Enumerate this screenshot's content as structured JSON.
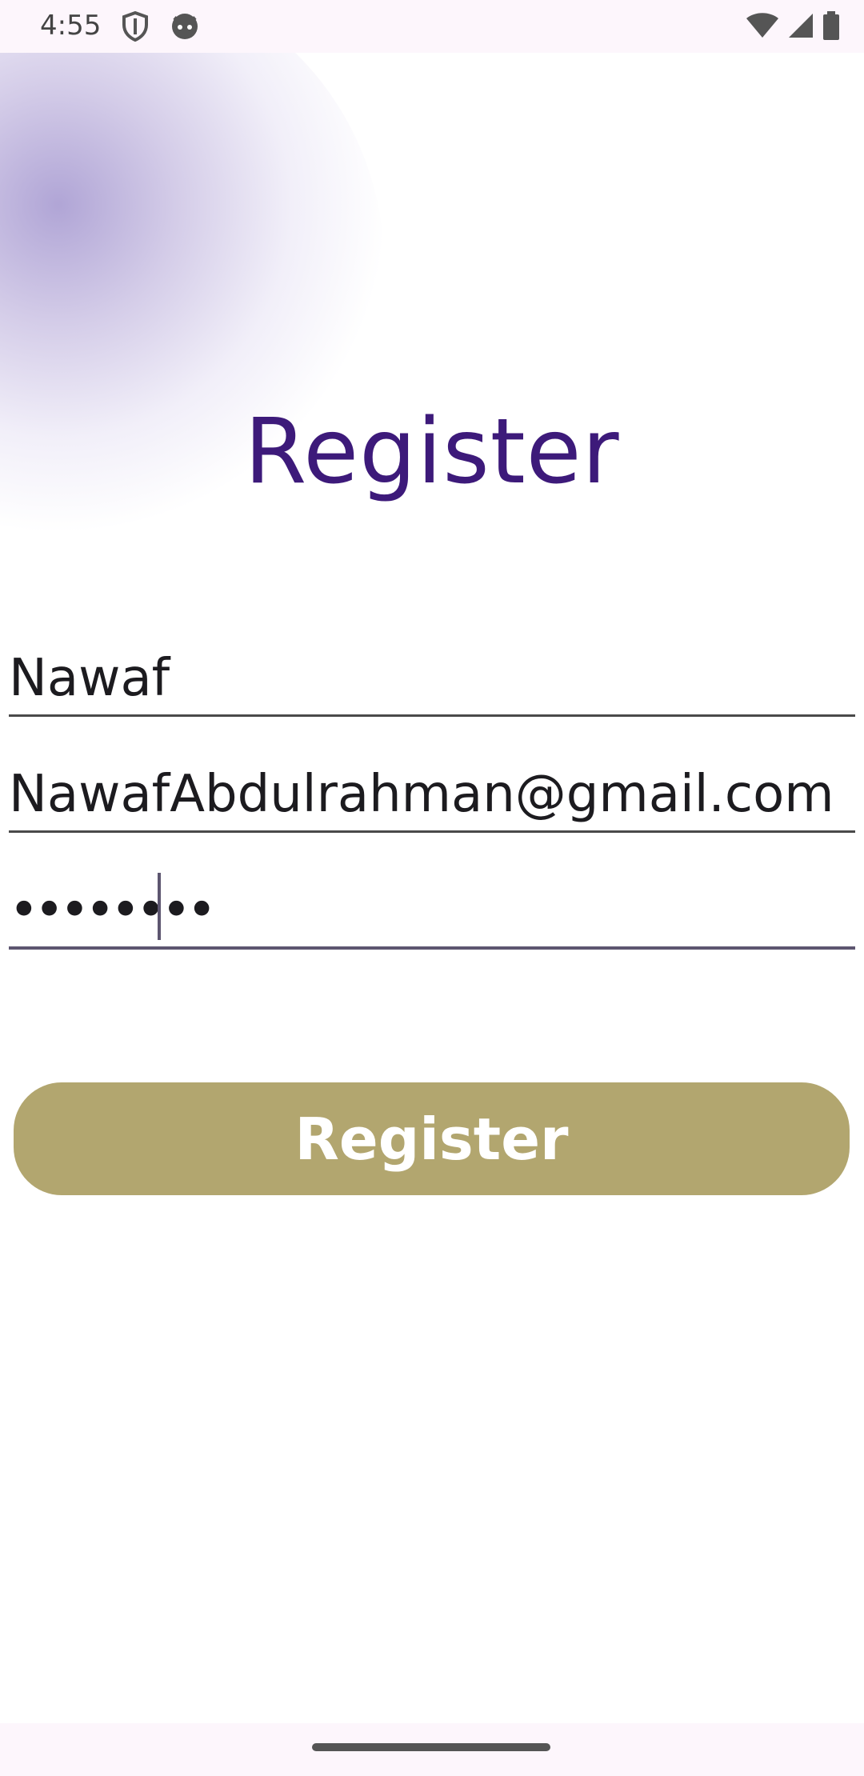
{
  "status_bar": {
    "time": "4:55",
    "icons": [
      "shield-icon",
      "cat-face-icon",
      "wifi-icon",
      "cellular-signal-icon",
      "battery-icon"
    ]
  },
  "page": {
    "title": "Register"
  },
  "form": {
    "name_value": "Nawaf",
    "email_value": "NawafAbdulrahman@gmail.com",
    "password_value": "••••••••",
    "submit_label": "Register"
  },
  "colors": {
    "title": "#3d1a7a",
    "button_bg": "#b2a66f",
    "button_text": "#ffffff",
    "underline": "#4a4a4a"
  }
}
